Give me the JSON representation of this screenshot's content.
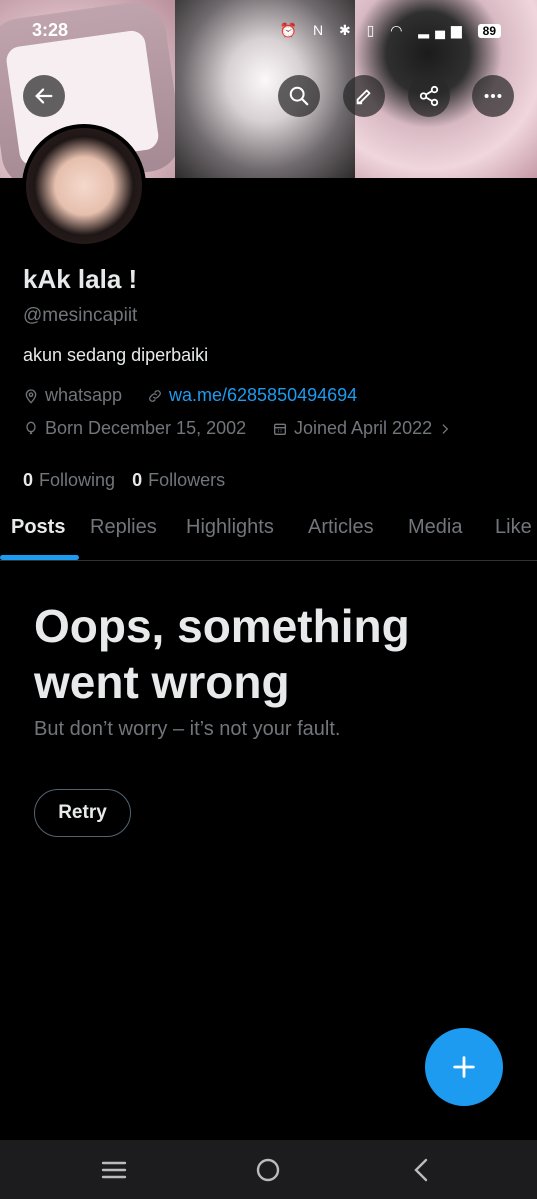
{
  "status_bar": {
    "time": "3:28",
    "battery": "89"
  },
  "header": {
    "back_icon": "arrow-left-icon",
    "actions": [
      "search-icon",
      "edit-icon",
      "share-icon",
      "more-icon"
    ]
  },
  "profile": {
    "name": "kAk lala !",
    "handle": "@mesincapiit",
    "bio": "akun sedang diperbaiki",
    "location": "whatsapp",
    "link": "wa.me/6285850494694",
    "birthday": "Born December 15, 2002",
    "joined": "Joined April 2022",
    "following_count": "0",
    "following_label": "Following",
    "followers_count": "0",
    "followers_label": "Followers"
  },
  "tabs": [
    {
      "label": "Posts",
      "active": true
    },
    {
      "label": "Replies"
    },
    {
      "label": "Highlights"
    },
    {
      "label": "Articles"
    },
    {
      "label": "Media"
    },
    {
      "label": "Like"
    }
  ],
  "error": {
    "title": "Oops, something went wrong",
    "subtitle": "But don’t worry – it’s not your fault.",
    "retry_label": "Retry"
  },
  "colors": {
    "accent": "#1d9bf0",
    "background": "#000000",
    "muted": "#71767b"
  },
  "nav": [
    "recents-icon",
    "home-icon",
    "back-icon"
  ]
}
